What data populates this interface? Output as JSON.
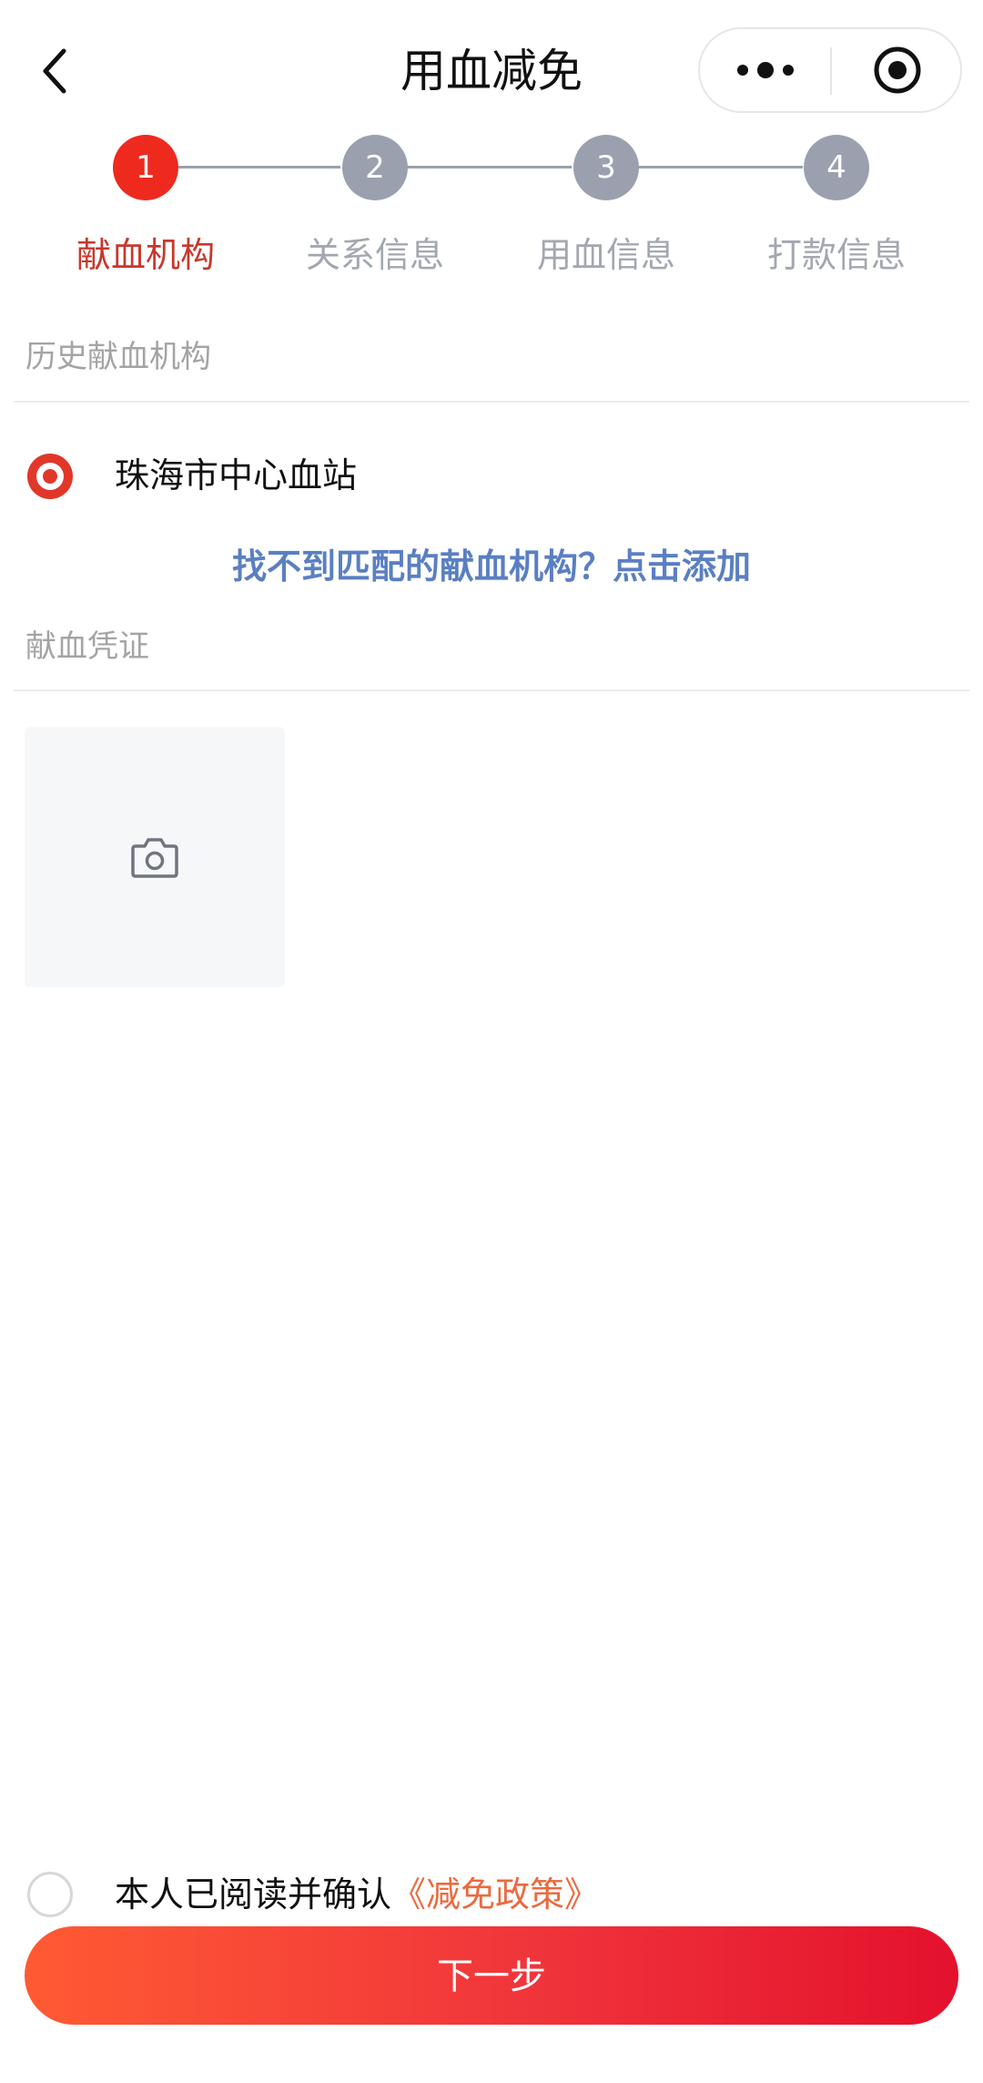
{
  "navbar": {
    "title": "用血减免"
  },
  "stepper": {
    "steps": [
      {
        "number": "1",
        "label": "献血机构",
        "state": "active"
      },
      {
        "number": "2",
        "label": "关系信息",
        "state": "inactive"
      },
      {
        "number": "3",
        "label": "用血信息",
        "state": "inactive"
      },
      {
        "number": "4",
        "label": "打款信息",
        "state": "inactive"
      }
    ]
  },
  "institution": {
    "section_label": "历史献血机构",
    "options": [
      {
        "name": "珠海市中心血站",
        "selected": true
      }
    ],
    "add_link": "找不到匹配的献血机构？点击添加"
  },
  "voucher": {
    "section_label": "献血凭证",
    "upload_icon": "camera-icon"
  },
  "agreement": {
    "text": "本人已阅读并确认",
    "policy_link": "《减免政策》",
    "checked": false
  },
  "actions": {
    "next_label": "下一步"
  },
  "colors": {
    "accent_red": "#ee2a1f",
    "inactive_step": "#9aa0ae",
    "link_blue": "#5a7fc2",
    "policy_orange": "#ea6a3f"
  }
}
